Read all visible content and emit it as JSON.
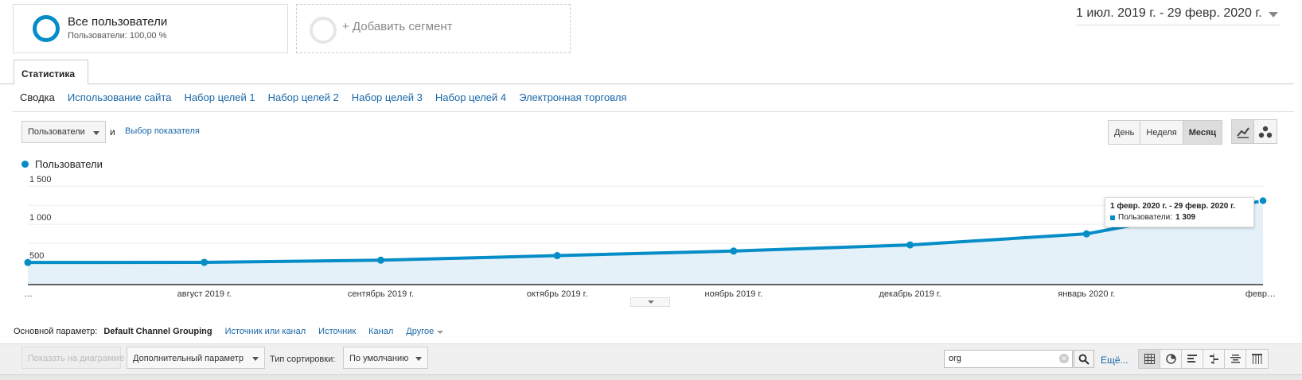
{
  "segments": {
    "all_users": {
      "title": "Все пользователи",
      "subtitle": "Пользователи: 100,00 %"
    },
    "add_segment": "+ Добавить сегмент"
  },
  "date_range": "1 июл. 2019 г. - 29 февр. 2020 г.",
  "tabs": {
    "statistics": "Статистика"
  },
  "subnav": [
    "Сводка",
    "Использование сайта",
    "Набор целей 1",
    "Набор целей 2",
    "Набор целей 3",
    "Набор целей 4",
    "Электронная торговля"
  ],
  "metric": {
    "selected": "Пользователи",
    "and": "и",
    "pick": "Выбор показателя"
  },
  "period": {
    "day": "День",
    "week": "Неделя",
    "month": "Месяц",
    "active": "Месяц"
  },
  "legend": {
    "label": "Пользователи",
    "color": "#058dc7"
  },
  "chart_data": {
    "type": "area",
    "series": [
      {
        "name": "Пользователи",
        "color": "#058dc7"
      }
    ],
    "x": [
      "…",
      "август 2019 г.",
      "сентябрь 2019 г.",
      "октябрь 2019 г.",
      "ноябрь 2019 г.",
      "декабрь 2019 г.",
      "январь 2020 г.",
      "февр…"
    ],
    "values": [
      500,
      502,
      530,
      590,
      650,
      730,
      875,
      1309
    ],
    "yticks": [
      "500",
      "1 000",
      "1 500"
    ],
    "ytick_values": [
      500,
      1000,
      1500
    ],
    "ylim": [
      210,
      1700
    ],
    "grid": true
  },
  "tooltip": {
    "title": "1 февр. 2020 г. - 29 февр. 2020 г.",
    "label": "Пользователи:",
    "value": "1 309"
  },
  "dimensions": {
    "label": "Основной параметр:",
    "current": "Default Channel Grouping",
    "options": [
      "Источник или канал",
      "Источник",
      "Канал"
    ],
    "other": "Другое"
  },
  "toolbar": {
    "plot": "Показать на диаграмме",
    "secondary": "Дополнительный параметр",
    "sort_label": "Тип сортировки:",
    "sort_value": "По умолчанию",
    "search_value": "org",
    "more": "Ещё..."
  }
}
